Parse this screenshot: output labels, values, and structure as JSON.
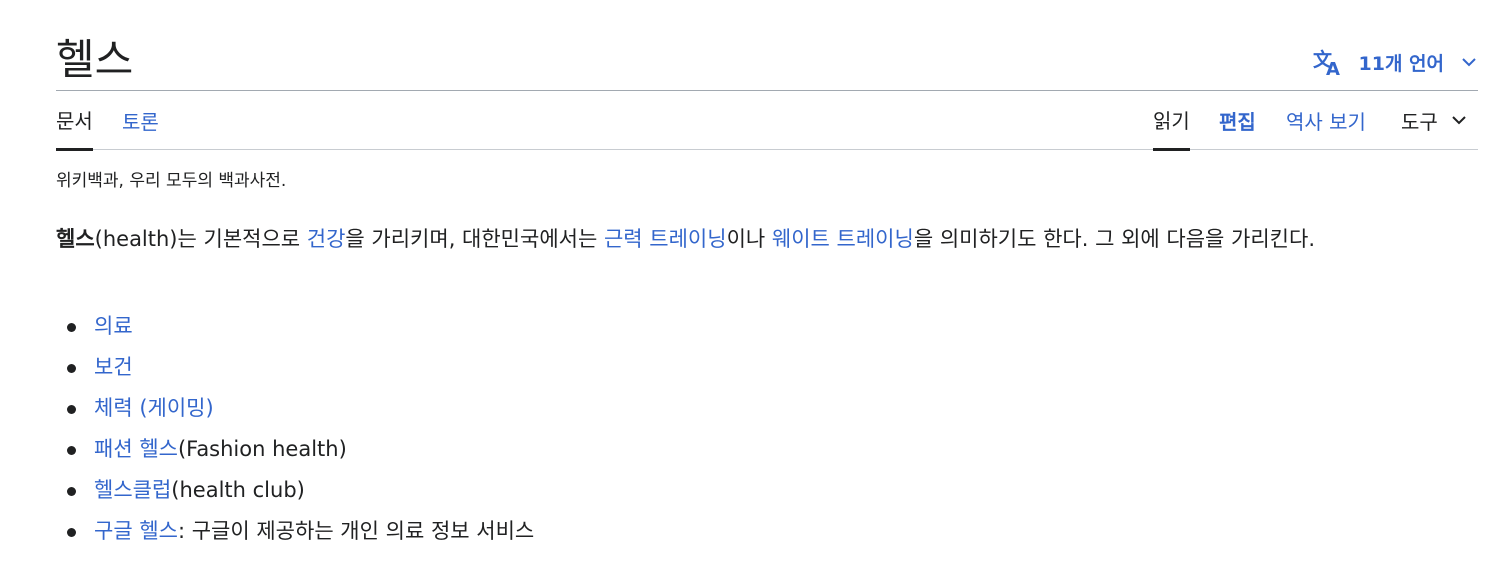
{
  "title": "헬스",
  "languages": {
    "label": "11개 언어",
    "icon": "translate-icon"
  },
  "tabs": {
    "article": "문서",
    "talk": "토론",
    "read": "읽기",
    "edit": "편집",
    "history": "역사 보기",
    "tools": "도구"
  },
  "tagline": "위키백과, 우리 모두의 백과사전.",
  "intro": {
    "term": "헬스",
    "part1": "(health)는 기본적으로 ",
    "link_health": "건강",
    "part2": "을 가리키며, 대한민국에서는 ",
    "link_strength": "근력 트레이닝",
    "part3": "이나 ",
    "link_weight": "웨이트 트레이닝",
    "part4": "을 의미하기도 한다. 그 외에 다음을 가리킨다."
  },
  "items": [
    {
      "link": "의료",
      "suffix": ""
    },
    {
      "link": "보건",
      "suffix": ""
    },
    {
      "link": "체력 (게이밍)",
      "suffix": ""
    },
    {
      "link": "패션 헬스",
      "suffix": "(Fashion health)"
    },
    {
      "link": "헬스클럽",
      "suffix": "(health club)"
    },
    {
      "link": "구글 헬스",
      "suffix": ": 구글이 제공하는 개인 의료 정보 서비스"
    }
  ],
  "colors": {
    "link": "#3366cc",
    "text": "#202122",
    "border": "#a2a9b1"
  }
}
